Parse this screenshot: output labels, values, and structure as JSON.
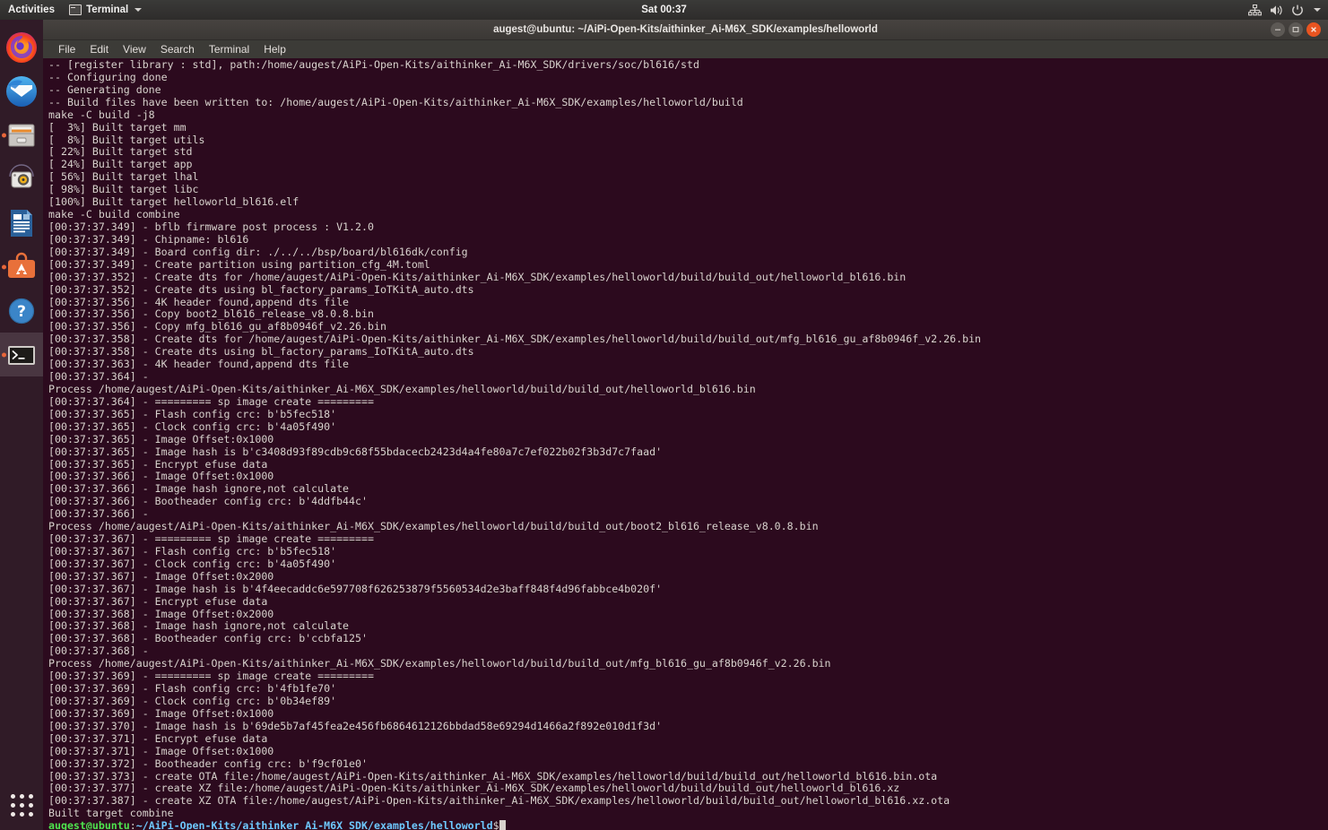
{
  "topbar": {
    "activities": "Activities",
    "app_menu": "Terminal",
    "clock": "Sat 00:37",
    "icons": [
      "network-icon",
      "volume-icon",
      "power-icon",
      "chevron-down-icon"
    ]
  },
  "dock": {
    "items": [
      {
        "name": "firefox",
        "label": "Firefox",
        "running": false
      },
      {
        "name": "thunderbird",
        "label": "Thunderbird Mail",
        "running": false
      },
      {
        "name": "files",
        "label": "Files",
        "running": true
      },
      {
        "name": "rhythmbox",
        "label": "Rhythmbox",
        "running": false
      },
      {
        "name": "libreoffice-writer",
        "label": "LibreOffice Writer",
        "running": false
      },
      {
        "name": "ubuntu-software",
        "label": "Ubuntu Software",
        "running": true
      },
      {
        "name": "help",
        "label": "Help",
        "running": false
      },
      {
        "name": "terminal",
        "label": "Terminal",
        "running": true
      }
    ],
    "show_applications": "Show Applications"
  },
  "window": {
    "title": "augest@ubuntu: ~/AiPi-Open-Kits/aithinker_Ai-M6X_SDK/examples/helloworld",
    "controls": [
      "minimize-button",
      "maximize-button",
      "close-button"
    ],
    "menu": [
      "File",
      "Edit",
      "View",
      "Search",
      "Terminal",
      "Help"
    ]
  },
  "terminal": {
    "prompt": {
      "user_host": "augest@ubuntu",
      "separator": ":",
      "path": "~/AiPi-Open-Kits/aithinker_Ai-M6X_SDK/examples/helloworld",
      "sigil": "$"
    },
    "colors": {
      "background": "#2c0a1e",
      "foreground": "#d8d2cd",
      "prompt_user": "#4ee44e",
      "prompt_path": "#6ec9ff"
    },
    "lines": [
      "-- [register library : std], path:/home/augest/AiPi-Open-Kits/aithinker_Ai-M6X_SDK/drivers/soc/bl616/std",
      "-- Configuring done",
      "-- Generating done",
      "-- Build files have been written to: /home/augest/AiPi-Open-Kits/aithinker_Ai-M6X_SDK/examples/helloworld/build",
      "make -C build -j8",
      "[  3%] Built target mm",
      "[  8%] Built target utils",
      "[ 22%] Built target std",
      "[ 24%] Built target app",
      "[ 56%] Built target lhal",
      "[ 98%] Built target libc",
      "[100%] Built target helloworld_bl616.elf",
      "make -C build combine",
      "[00:37:37.349] - bflb firmware post process : V1.2.0",
      "[00:37:37.349] - Chipname: bl616",
      "[00:37:37.349] - Board config dir: ./../../bsp/board/bl616dk/config",
      "[00:37:37.349] - Create partition using partition_cfg_4M.toml",
      "[00:37:37.352] - Create dts for /home/augest/AiPi-Open-Kits/aithinker_Ai-M6X_SDK/examples/helloworld/build/build_out/helloworld_bl616.bin",
      "[00:37:37.352] - Create dts using bl_factory_params_IoTKitA_auto.dts",
      "[00:37:37.356] - 4K header found,append dts file",
      "[00:37:37.356] - Copy boot2_bl616_release_v8.0.8.bin",
      "[00:37:37.356] - Copy mfg_bl616_gu_af8b0946f_v2.26.bin",
      "[00:37:37.358] - Create dts for /home/augest/AiPi-Open-Kits/aithinker_Ai-M6X_SDK/examples/helloworld/build/build_out/mfg_bl616_gu_af8b0946f_v2.26.bin",
      "[00:37:37.358] - Create dts using bl_factory_params_IoTKitA_auto.dts",
      "[00:37:37.363] - 4K header found,append dts file",
      "[00:37:37.364] - ",
      "Process /home/augest/AiPi-Open-Kits/aithinker_Ai-M6X_SDK/examples/helloworld/build/build_out/helloworld_bl616.bin",
      "[00:37:37.364] - ========= sp image create =========",
      "[00:37:37.365] - Flash config crc: b'b5fec518'",
      "[00:37:37.365] - Clock config crc: b'4a05f490'",
      "[00:37:37.365] - Image Offset:0x1000",
      "[00:37:37.365] - Image hash is b'c3408d93f89cdb9c68f55bdacecb2423d4a4fe80a7c7ef022b02f3b3d7c7faad'",
      "[00:37:37.365] - Encrypt efuse data",
      "[00:37:37.366] - Image Offset:0x1000",
      "[00:37:37.366] - Image hash ignore,not calculate",
      "[00:37:37.366] - Bootheader config crc: b'4ddfb44c'",
      "[00:37:37.366] - ",
      "Process /home/augest/AiPi-Open-Kits/aithinker_Ai-M6X_SDK/examples/helloworld/build/build_out/boot2_bl616_release_v8.0.8.bin",
      "[00:37:37.367] - ========= sp image create =========",
      "[00:37:37.367] - Flash config crc: b'b5fec518'",
      "[00:37:37.367] - Clock config crc: b'4a05f490'",
      "[00:37:37.367] - Image Offset:0x2000",
      "[00:37:37.367] - Image hash is b'4f4eecaddc6e597708f626253879f5560534d2e3baff848f4d96fabbce4b020f'",
      "[00:37:37.367] - Encrypt efuse data",
      "[00:37:37.368] - Image Offset:0x2000",
      "[00:37:37.368] - Image hash ignore,not calculate",
      "[00:37:37.368] - Bootheader config crc: b'ccbfa125'",
      "[00:37:37.368] - ",
      "Process /home/augest/AiPi-Open-Kits/aithinker_Ai-M6X_SDK/examples/helloworld/build/build_out/mfg_bl616_gu_af8b0946f_v2.26.bin",
      "[00:37:37.369] - ========= sp image create =========",
      "[00:37:37.369] - Flash config crc: b'4fb1fe70'",
      "[00:37:37.369] - Clock config crc: b'0b34ef89'",
      "[00:37:37.369] - Image Offset:0x1000",
      "[00:37:37.370] - Image hash is b'69de5b7af45fea2e456fb6864612126bbdad58e69294d1466a2f892e010d1f3d'",
      "[00:37:37.371] - Encrypt efuse data",
      "[00:37:37.371] - Image Offset:0x1000",
      "[00:37:37.372] - Bootheader config crc: b'f9cf01e0'",
      "[00:37:37.373] - create OTA file:/home/augest/AiPi-Open-Kits/aithinker_Ai-M6X_SDK/examples/helloworld/build/build_out/helloworld_bl616.bin.ota",
      "[00:37:37.377] - create XZ file:/home/augest/AiPi-Open-Kits/aithinker_Ai-M6X_SDK/examples/helloworld/build/build_out/helloworld_bl616.xz",
      "[00:37:37.387] - create XZ OTA file:/home/augest/AiPi-Open-Kits/aithinker_Ai-M6X_SDK/examples/helloworld/build/build_out/helloworld_bl616.xz.ota",
      "Built target combine"
    ]
  }
}
